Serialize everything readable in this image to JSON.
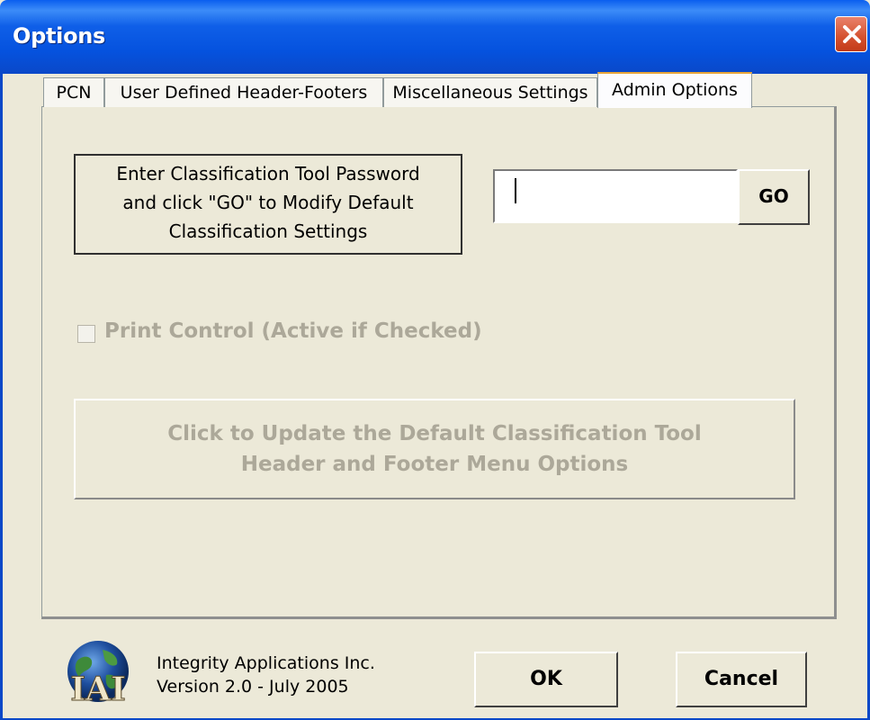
{
  "window": {
    "title": "Options"
  },
  "tabs": [
    {
      "label": "PCN",
      "active": false
    },
    {
      "label": "User Defined Header-Footers",
      "active": false
    },
    {
      "label": "Miscellaneous Settings",
      "active": false
    },
    {
      "label": "Admin Options",
      "active": true
    }
  ],
  "admin": {
    "instruction_lines": [
      "Enter Classification Tool Password",
      "and click \"GO\" to Modify Default",
      "Classification Settings"
    ],
    "password_value": "",
    "go_label": "GO",
    "print_control": {
      "label": "Print Control (Active if Checked)",
      "checked": false,
      "enabled": false
    },
    "update_button_lines": [
      "Click to Update the Default Classification Tool",
      "Header and Footer Menu Options"
    ]
  },
  "footer": {
    "logo_text": "IAI",
    "company": "Integrity Applications Inc.",
    "version": "Version 2.0 - July 2005",
    "ok_label": "OK",
    "cancel_label": "Cancel"
  },
  "colors": {
    "titlebar": "#0A5EEF",
    "close": "#D4502E",
    "face": "#ECE9D8",
    "disabled_text": "#ACA899",
    "active_tab_accent": "#E8A53A"
  }
}
